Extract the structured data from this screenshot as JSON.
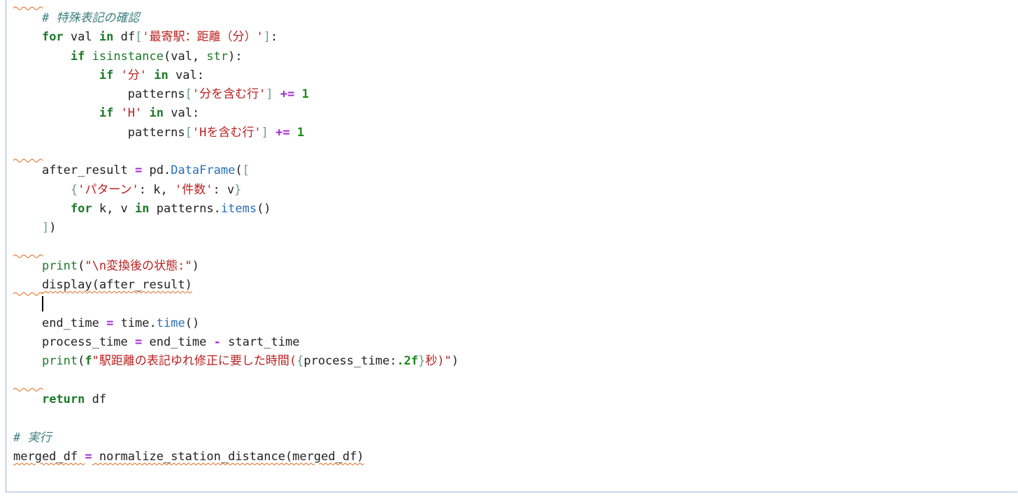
{
  "editor": {
    "lines": [
      {
        "indent": "    ",
        "tokens": [
          {
            "t": "# 特殊表記の確認",
            "c": "cm"
          }
        ],
        "squiggle": true
      },
      {
        "indent": "    ",
        "tokens": [
          {
            "t": "for",
            "c": "kw"
          },
          {
            "t": " val ",
            "c": ""
          },
          {
            "t": "in",
            "c": "kw"
          },
          {
            "t": " df",
            "c": ""
          },
          {
            "t": "[",
            "c": "br"
          },
          {
            "t": "'最寄駅：距離（分）'",
            "c": "str"
          },
          {
            "t": "]",
            "c": "br"
          },
          {
            "t": ":",
            "c": ""
          }
        ]
      },
      {
        "indent": "        ",
        "tokens": [
          {
            "t": "if",
            "c": "kw"
          },
          {
            "t": " ",
            "c": ""
          },
          {
            "t": "isinstance",
            "c": "bi"
          },
          {
            "t": "(val, ",
            "c": ""
          },
          {
            "t": "str",
            "c": "bi"
          },
          {
            "t": "):",
            "c": ""
          }
        ]
      },
      {
        "indent": "            ",
        "tokens": [
          {
            "t": "if",
            "c": "kw"
          },
          {
            "t": " ",
            "c": ""
          },
          {
            "t": "'分'",
            "c": "str"
          },
          {
            "t": " ",
            "c": ""
          },
          {
            "t": "in",
            "c": "kw"
          },
          {
            "t": " val:",
            "c": ""
          }
        ]
      },
      {
        "indent": "                ",
        "tokens": [
          {
            "t": "patterns",
            "c": ""
          },
          {
            "t": "[",
            "c": "br"
          },
          {
            "t": "'分を含む行'",
            "c": "str"
          },
          {
            "t": "]",
            "c": "br"
          },
          {
            "t": " ",
            "c": ""
          },
          {
            "t": "+=",
            "c": "op"
          },
          {
            "t": " ",
            "c": ""
          },
          {
            "t": "1",
            "c": "num"
          }
        ]
      },
      {
        "indent": "            ",
        "tokens": [
          {
            "t": "if",
            "c": "kw"
          },
          {
            "t": " ",
            "c": ""
          },
          {
            "t": "'H'",
            "c": "str"
          },
          {
            "t": " ",
            "c": ""
          },
          {
            "t": "in",
            "c": "kw"
          },
          {
            "t": " val:",
            "c": ""
          }
        ]
      },
      {
        "indent": "                ",
        "tokens": [
          {
            "t": "patterns",
            "c": ""
          },
          {
            "t": "[",
            "c": "br"
          },
          {
            "t": "'Hを含む行'",
            "c": "str"
          },
          {
            "t": "]",
            "c": "br"
          },
          {
            "t": " ",
            "c": ""
          },
          {
            "t": "+=",
            "c": "op"
          },
          {
            "t": " ",
            "c": ""
          },
          {
            "t": "1",
            "c": "num"
          }
        ]
      },
      {
        "indent": "",
        "tokens": []
      },
      {
        "indent": "    ",
        "tokens": [
          {
            "t": "after_result ",
            "c": ""
          },
          {
            "t": "=",
            "c": "op"
          },
          {
            "t": " pd.",
            "c": ""
          },
          {
            "t": "DataFrame",
            "c": "fn"
          },
          {
            "t": "(",
            "c": ""
          },
          {
            "t": "[",
            "c": "br"
          }
        ],
        "squiggle": true
      },
      {
        "indent": "        ",
        "tokens": [
          {
            "t": "{",
            "c": "br"
          },
          {
            "t": "'パターン'",
            "c": "str"
          },
          {
            "t": ": k, ",
            "c": ""
          },
          {
            "t": "'件数'",
            "c": "str"
          },
          {
            "t": ": v",
            "c": ""
          },
          {
            "t": "}",
            "c": "br"
          }
        ]
      },
      {
        "indent": "        ",
        "tokens": [
          {
            "t": "for",
            "c": "kw"
          },
          {
            "t": " k, v ",
            "c": ""
          },
          {
            "t": "in",
            "c": "kw"
          },
          {
            "t": " patterns.",
            "c": ""
          },
          {
            "t": "items",
            "c": "fn"
          },
          {
            "t": "()",
            "c": ""
          }
        ]
      },
      {
        "indent": "    ",
        "tokens": [
          {
            "t": "]",
            "c": "br"
          },
          {
            "t": ")",
            "c": ""
          }
        ]
      },
      {
        "indent": "",
        "tokens": []
      },
      {
        "indent": "    ",
        "tokens": [
          {
            "t": "print",
            "c": "bi"
          },
          {
            "t": "(",
            "c": ""
          },
          {
            "t": "\"\\n変換後の状態:\"",
            "c": "str"
          },
          {
            "t": ")",
            "c": ""
          }
        ],
        "squiggle": true
      },
      {
        "indent": "    ",
        "tokens": [
          {
            "t": "display(after_result)",
            "c": "wavy"
          }
        ]
      },
      {
        "indent": "    ",
        "tokens": [],
        "cursor": true,
        "squiggle": true
      },
      {
        "indent": "    ",
        "tokens": [
          {
            "t": "end_time ",
            "c": ""
          },
          {
            "t": "=",
            "c": "op"
          },
          {
            "t": " time.",
            "c": ""
          },
          {
            "t": "time",
            "c": "fn"
          },
          {
            "t": "()",
            "c": ""
          }
        ]
      },
      {
        "indent": "    ",
        "tokens": [
          {
            "t": "process_time ",
            "c": ""
          },
          {
            "t": "=",
            "c": "op"
          },
          {
            "t": " end_time ",
            "c": ""
          },
          {
            "t": "-",
            "c": "op"
          },
          {
            "t": " start_time",
            "c": ""
          }
        ]
      },
      {
        "indent": "    ",
        "tokens": [
          {
            "t": "print",
            "c": "bi"
          },
          {
            "t": "(",
            "c": ""
          },
          {
            "t": "f",
            "c": "kw"
          },
          {
            "t": "\"駅距離の表記ゆれ修正に要した時間(",
            "c": "str"
          },
          {
            "t": "{",
            "c": "br"
          },
          {
            "t": "process_time:",
            "c": ""
          },
          {
            "t": ".2f",
            "c": "num"
          },
          {
            "t": "}",
            "c": "br"
          },
          {
            "t": "秒)\"",
            "c": "str"
          },
          {
            "t": ")",
            "c": ""
          }
        ]
      },
      {
        "indent": "",
        "tokens": []
      },
      {
        "indent": "    ",
        "tokens": [
          {
            "t": "return",
            "c": "kw"
          },
          {
            "t": " df",
            "c": ""
          }
        ],
        "squiggle": true
      },
      {
        "indent": "",
        "tokens": []
      },
      {
        "indent": "",
        "tokens": [
          {
            "t": "# 実行",
            "c": "cm"
          }
        ]
      },
      {
        "indent": "",
        "tokens": [
          {
            "t": "merged_df ",
            "c": "wavy"
          },
          {
            "t": "=",
            "c": "op"
          },
          {
            "t": " normalize_station_distance(merged_df)",
            "c": "wavy"
          }
        ]
      }
    ]
  },
  "colors": {
    "keyword": "#1b7a28",
    "string": "#ba2121",
    "comment": "#3f7f7f",
    "operator": "#a22bd3",
    "number": "#1b8a1b",
    "function": "#2a6fb8",
    "squiggle": "#e06c1f",
    "border": "#9bb6d6"
  }
}
